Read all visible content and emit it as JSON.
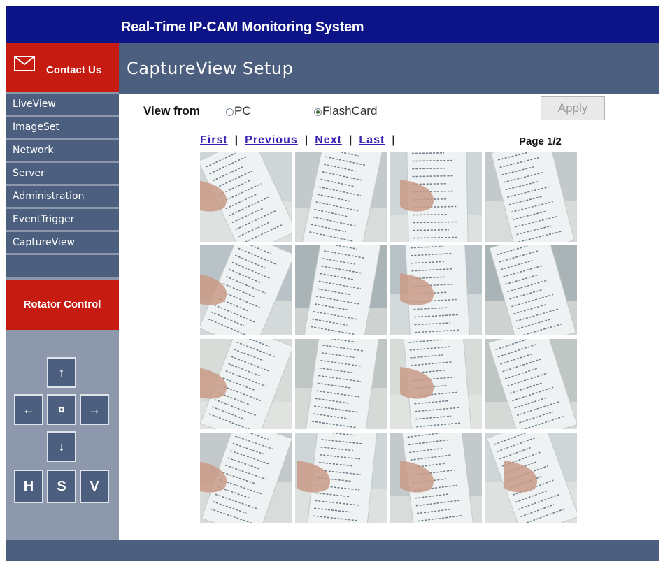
{
  "app": {
    "title": "Real-Time IP-CAM Monitoring System"
  },
  "contact": {
    "label": "Contact Us",
    "icon": "envelope-icon"
  },
  "page": {
    "title": "CaptureView Setup"
  },
  "sidebar": {
    "items": [
      {
        "label": "LiveView"
      },
      {
        "label": "ImageSet"
      },
      {
        "label": "Network"
      },
      {
        "label": "Server"
      },
      {
        "label": "Administration"
      },
      {
        "label": "EventTrigger"
      },
      {
        "label": "CaptureView"
      }
    ]
  },
  "rotator": {
    "title": "Rotator Control",
    "up": "↑",
    "down": "↓",
    "left": "←",
    "right": "→",
    "center": "¤",
    "h": "H",
    "s": "S",
    "v": "V"
  },
  "view_from": {
    "label": "View from",
    "options": [
      {
        "label": "PC",
        "selected": false
      },
      {
        "label": "FlashCard",
        "selected": true
      }
    ],
    "apply": "Apply"
  },
  "pager": {
    "first": "First",
    "previous": "Previous",
    "next": "Next",
    "last": "Last",
    "separator": "|",
    "page": "Page 1/2"
  },
  "gallery": {
    "rows": 4,
    "cols": 4,
    "count": 16,
    "description": "captured camera images of handwritten receipts"
  },
  "colors": {
    "title_bar": "#0d1488",
    "header": "#4d5f7e",
    "accent_red": "#c61b10",
    "sidebar_bg": "#8e98ad",
    "link": "#3b1eb0"
  }
}
